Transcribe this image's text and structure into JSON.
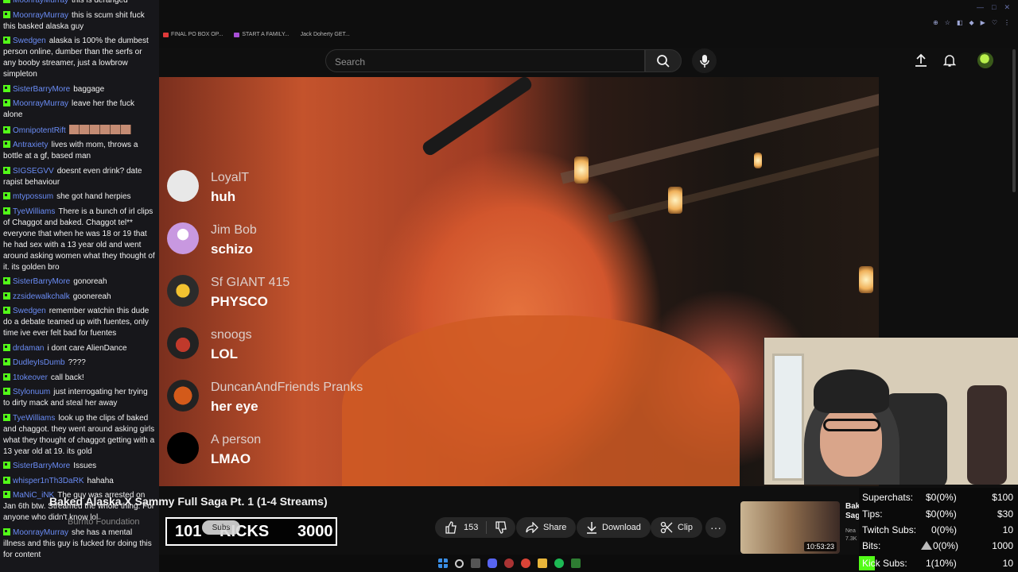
{
  "browser": {
    "bookmarks": [
      "FINAL PO BOX OP...",
      "START A FAMILY...",
      "Jack Doherty GET..."
    ]
  },
  "header": {
    "search_placeholder": "Search"
  },
  "video_overlay_chat": [
    {
      "name": "LoyalT",
      "text": "huh",
      "avatar_color": "#e8e8e8"
    },
    {
      "name": "Jim Bob",
      "text": "schizo",
      "avatar_color": "#c898e0"
    },
    {
      "name": "Sf GIANT 415",
      "text": "PHYSCO",
      "avatar_color": "#f2c230"
    },
    {
      "name": "snoogs",
      "text": "LOL",
      "avatar_color": "#c0392b"
    },
    {
      "name": "DuncanAndFriends Pranks",
      "text": "her eye",
      "avatar_color": "#d35a1a"
    },
    {
      "name": "A person",
      "text": "LMAO",
      "avatar_color": "#000000"
    }
  ],
  "chat": [
    {
      "user": "MoonrayMurray",
      "text": "this is deranged"
    },
    {
      "user": "MoonrayMurray",
      "text": "this is scum shit fuck this basked alaska guy"
    },
    {
      "user": "Swedgen",
      "text": "alaska is 100% the dumbest person online, dumber than the serfs or any booby streamer, just a lowbrow simpleton"
    },
    {
      "user": "SisterBarryMore",
      "text": "baggage"
    },
    {
      "user": "MoonrayMurray",
      "text": "leave her the fuck alone"
    },
    {
      "user": "OmnipotentRift",
      "text": "",
      "emotes": true
    },
    {
      "user": "Antraxiety",
      "text": "lives with mom, throws a bottle at a gf, based man"
    },
    {
      "user": "SIGSEGVV",
      "text": "doesnt even drink? date rapist behaviour"
    },
    {
      "user": "mtypossum",
      "text": "she got hand herpies"
    },
    {
      "user": "TyeWilliams",
      "text": "There is a bunch of irl clips of Chaggot and baked. Chaggot tel** everyone that when he was 18 or 19 that he had sex with a 13 year old and went around asking women what they thought of it. its golden bro"
    },
    {
      "user": "SisterBarryMore",
      "text": "gonoreah"
    },
    {
      "user": "zzsidewalkchalk",
      "text": "goonereah"
    },
    {
      "user": "Swedgen",
      "text": "remember watchin this dude do a debate teamed up with fuentes, only time ive ever felt bad for fuentes"
    },
    {
      "user": "drdaman",
      "text": "i dont care AlienDance"
    },
    {
      "user": "DudleyIsDumb",
      "text": "????"
    },
    {
      "user": "1tokeover",
      "text": "call back!"
    },
    {
      "user": "Stylonuum",
      "text": "just interrogating her trying to dirty mack and steal her away"
    },
    {
      "user": "TyeWilliams",
      "text": "look up the clips of baked and chaggot. they went around asking girls what they thought of chaggot getting with a 13 year old at 19. its gold"
    },
    {
      "user": "SisterBarryMore",
      "text": "Issues"
    },
    {
      "user": "whisper1nTh3DaRK",
      "text": "hahaha"
    },
    {
      "user": "MaNiC_iNK",
      "text": "The guy was arrested on Jan 6th btw. Streamed the whole thing. For anyone who didn't know lol"
    },
    {
      "user": "MoonrayMurray",
      "text": "she has a mental illness and this guy is fucked for doing this for content"
    }
  ],
  "video": {
    "title": "Baked Alaska X Sammy Full Saga Pt. 1 (1-4 Streams)",
    "channel_foundation": "Burrito Foundation",
    "subscribe_label": "Subs",
    "like_count": "153",
    "share_label": "Share",
    "download_label": "Download",
    "clip_label": "Clip",
    "more_label": "···"
  },
  "alert_box": {
    "left": "101",
    "mid": "KICKS",
    "right": "3000"
  },
  "recommended": {
    "title": "Bak Sag",
    "meta": "Nea 7.3K",
    "duration": "10:53:23"
  },
  "stats": [
    {
      "label": "Superchats:",
      "value": "$0(0%)",
      "goal": "$100"
    },
    {
      "label": "Tips:",
      "value": "$0(0%)",
      "goal": "$30"
    },
    {
      "label": "Twitch Subs:",
      "value": "0(0%)",
      "goal": "10"
    },
    {
      "label": "Bits:",
      "value": "0(0%)",
      "goal": "1000"
    },
    {
      "label": "Kick Subs:",
      "value": "1(10%)",
      "goal": "10"
    }
  ],
  "colors": {
    "kick_green": "#53fc18",
    "chat_username": "#6a8cf5",
    "bg": "#0f0f0f"
  }
}
